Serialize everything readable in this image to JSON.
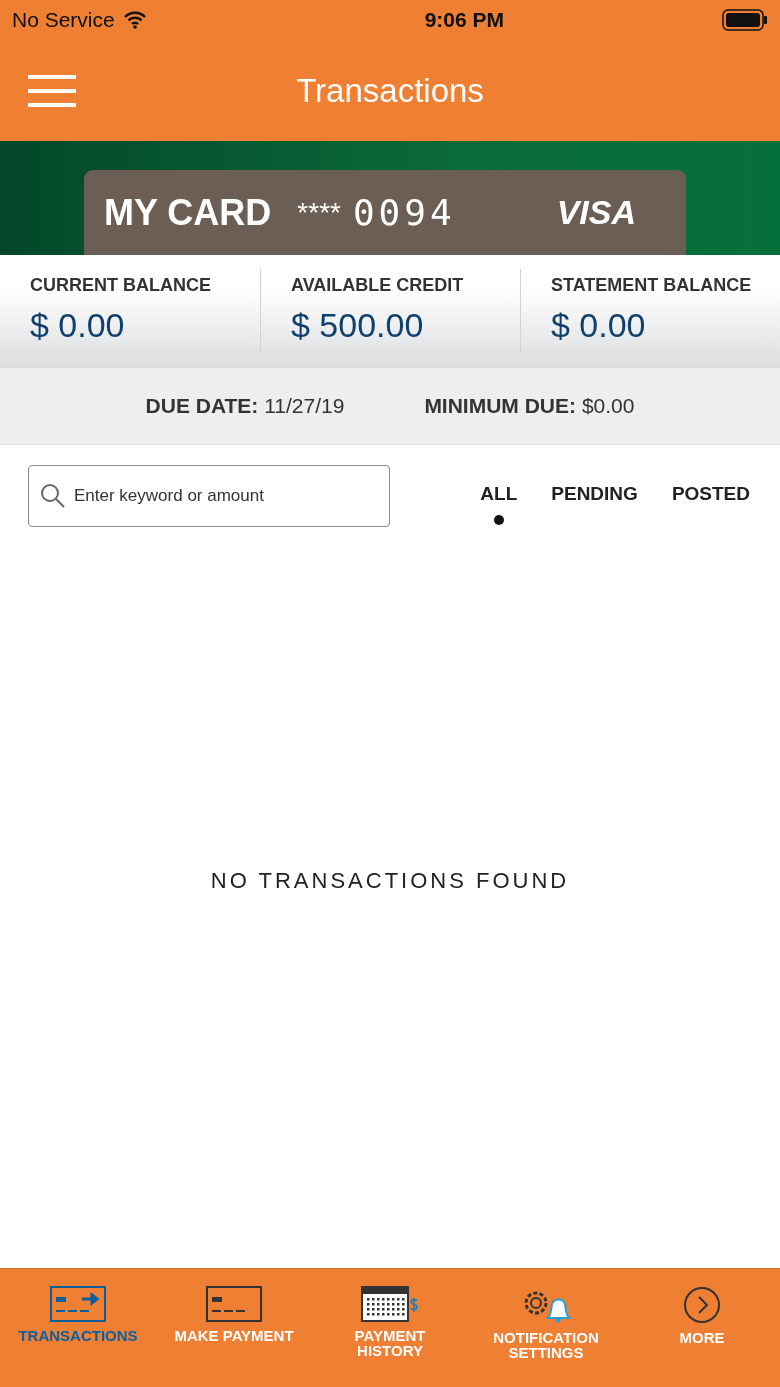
{
  "status_bar": {
    "carrier": "No Service",
    "time": "9:06 PM"
  },
  "header": {
    "title": "Transactions"
  },
  "card": {
    "name": "MY CARD",
    "mask": "****",
    "last_digits": "0094",
    "network": "VISA"
  },
  "balances": [
    {
      "label": "CURRENT BALANCE",
      "value": "$ 0.00"
    },
    {
      "label": "AVAILABLE CREDIT",
      "value": "$ 500.00"
    },
    {
      "label": "STATEMENT BALANCE",
      "value": "$ 0.00"
    }
  ],
  "due": [
    {
      "label": "DUE DATE:",
      "value": "11/27/19"
    },
    {
      "label": "MINIMUM DUE:",
      "value": "$0.00"
    }
  ],
  "search": {
    "placeholder": "Enter keyword or amount"
  },
  "filters": [
    {
      "label": "ALL",
      "selected": true
    },
    {
      "label": "PENDING",
      "selected": false
    },
    {
      "label": "POSTED",
      "selected": false
    }
  ],
  "empty_message": "NO TRANSACTIONS FOUND",
  "tab_bar": [
    {
      "kind": "transactions",
      "label": "TRANSACTIONS",
      "selected": true
    },
    {
      "kind": "payment",
      "label": "MAKE PAYMENT",
      "selected": false
    },
    {
      "kind": "history",
      "label": "PAYMENT HISTORY",
      "selected": false
    },
    {
      "kind": "notifications",
      "label": "NOTIFICATION SETTINGS",
      "selected": false
    },
    {
      "kind": "more",
      "label": "MORE",
      "selected": false
    }
  ]
}
